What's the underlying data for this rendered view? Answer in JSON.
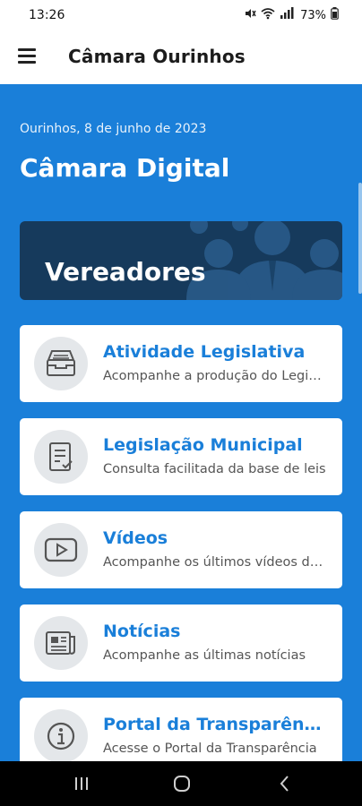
{
  "status": {
    "time": "13:26",
    "battery": "73%",
    "icons": [
      "mute-icon",
      "wifi-icon",
      "signal-icon",
      "battery-icon"
    ]
  },
  "header": {
    "title": "Câmara Ourinhos",
    "menu_icon": "hamburger-menu-icon"
  },
  "main": {
    "date": "Ourinhos, 8 de junho de 2023",
    "title": "Câmara Digital",
    "banner": {
      "label": "Vereadores",
      "background": "#163a5c"
    },
    "cards": [
      {
        "title": "Atividade Legislativa",
        "subtitle": "Acompanhe a produção do Legislativo",
        "icon": "archive-box-icon"
      },
      {
        "title": "Legislação Municipal",
        "subtitle": "Consulta facilitada da base de leis",
        "icon": "document-check-icon"
      },
      {
        "title": "Vídeos",
        "subtitle": "Acompanhe os últimos vídeos da Câmara",
        "icon": "video-play-icon"
      },
      {
        "title": "Notícias",
        "subtitle": "Acompanhe as últimas notícias",
        "icon": "newspaper-icon"
      },
      {
        "title": "Portal da Transparência",
        "subtitle": "Acesse o Portal da Transparência",
        "icon": "info-icon"
      }
    ]
  },
  "nav": {
    "buttons": [
      "recent-apps-icon",
      "home-icon",
      "back-icon"
    ]
  },
  "colors": {
    "accent": "#1a7fd9",
    "banner": "#163a5c",
    "card": "#ffffff",
    "icon_circle": "#e4e7ea"
  }
}
